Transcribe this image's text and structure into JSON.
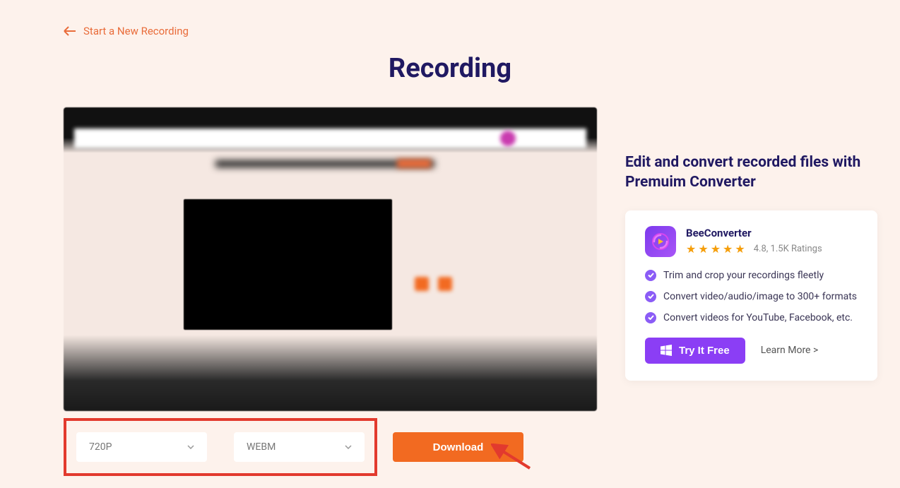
{
  "header": {
    "back_link": "Start a New Recording",
    "page_title": "Recording"
  },
  "downloads": {
    "resolution_selected": "720P",
    "format_selected": "WEBM",
    "download_button": "Download"
  },
  "promo": {
    "title": "Edit and convert recorded files with Premuim Converter",
    "product_name": "BeeConverter",
    "rating_text": "4.8, 1.5K Ratings",
    "features": [
      "Trim and crop your recordings fleetly",
      "Convert video/audio/image to 300+ formats",
      "Convert videos for YouTube, Facebook, etc."
    ],
    "try_button": "Try It Free",
    "learn_more": "Learn More >"
  },
  "colors": {
    "accent_orange": "#f26a21",
    "accent_purple": "#8b3ef5",
    "annotation_red": "#e23a2e",
    "heading_navy": "#201962"
  }
}
